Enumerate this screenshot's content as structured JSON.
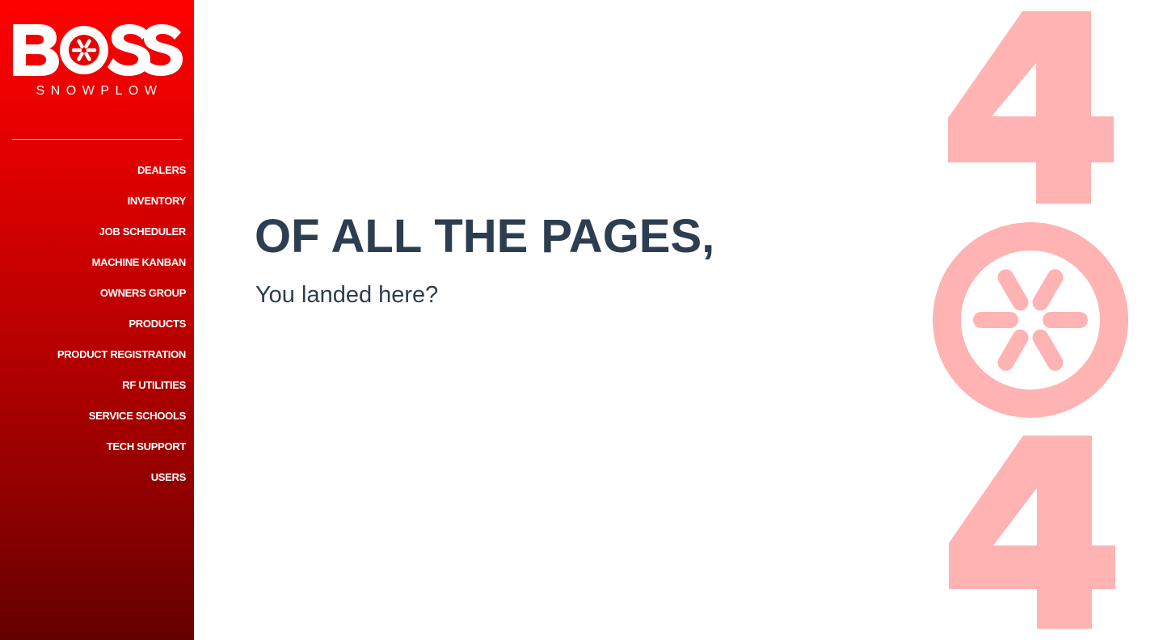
{
  "brand": {
    "wordmark": "BOSS",
    "subtitle": "SNOWPLOW",
    "red": "#ff0000",
    "dark_red": "#650000"
  },
  "sidebar": {
    "items": [
      {
        "label": "DEALERS"
      },
      {
        "label": "INVENTORY"
      },
      {
        "label": "JOB SCHEDULER"
      },
      {
        "label": "MACHINE KANBAN"
      },
      {
        "label": "OWNERS GROUP"
      },
      {
        "label": "PRODUCTS"
      },
      {
        "label": "PRODUCT REGISTRATION"
      },
      {
        "label": "RF UTILITIES"
      },
      {
        "label": "SERVICE SCHOOLS"
      },
      {
        "label": "TECH SUPPORT"
      },
      {
        "label": "USERS"
      }
    ]
  },
  "main": {
    "headline": "OF ALL THE PAGES,",
    "subline": "You landed here?",
    "text_color": "#2c3e50"
  },
  "error_graphic": {
    "code": "404",
    "color": "#ffb3b3",
    "middle_icon": "boss-wheel-icon"
  }
}
